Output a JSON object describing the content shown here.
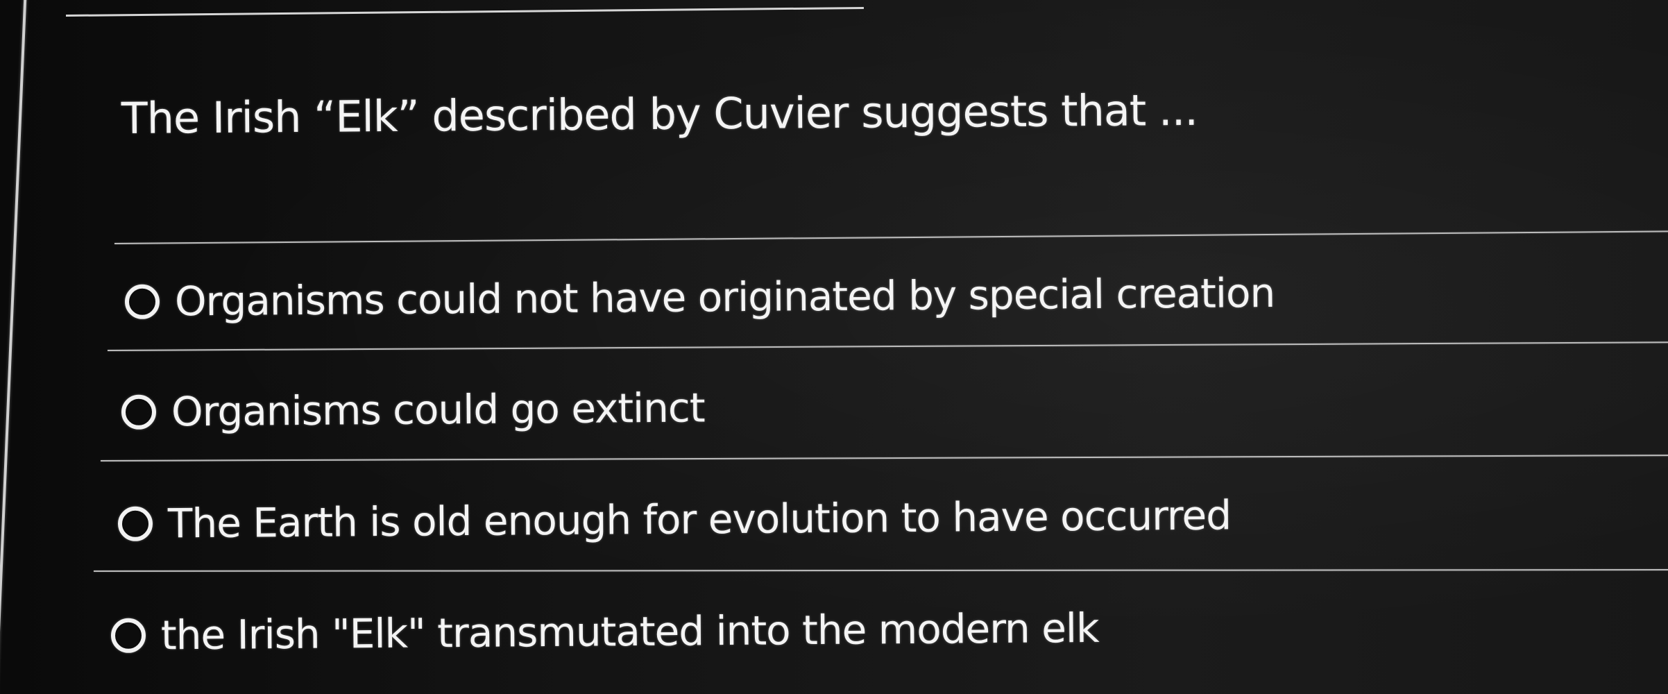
{
  "quiz": {
    "question": "The Irish “Elk” described by Cuvier suggests that ...",
    "options": [
      {
        "label": "Organisms could not have originated by special creation",
        "selected": false
      },
      {
        "label": "Organisms could go extinct",
        "selected": false
      },
      {
        "label": "The Earth is old enough for evolution to have occurred",
        "selected": false
      },
      {
        "label": "the Irish \"Elk\" transmutated into the modern elk",
        "selected": false
      }
    ]
  },
  "colors": {
    "background": "#141414",
    "text": "#f4f4f4",
    "divider": "#bdbdbd"
  }
}
